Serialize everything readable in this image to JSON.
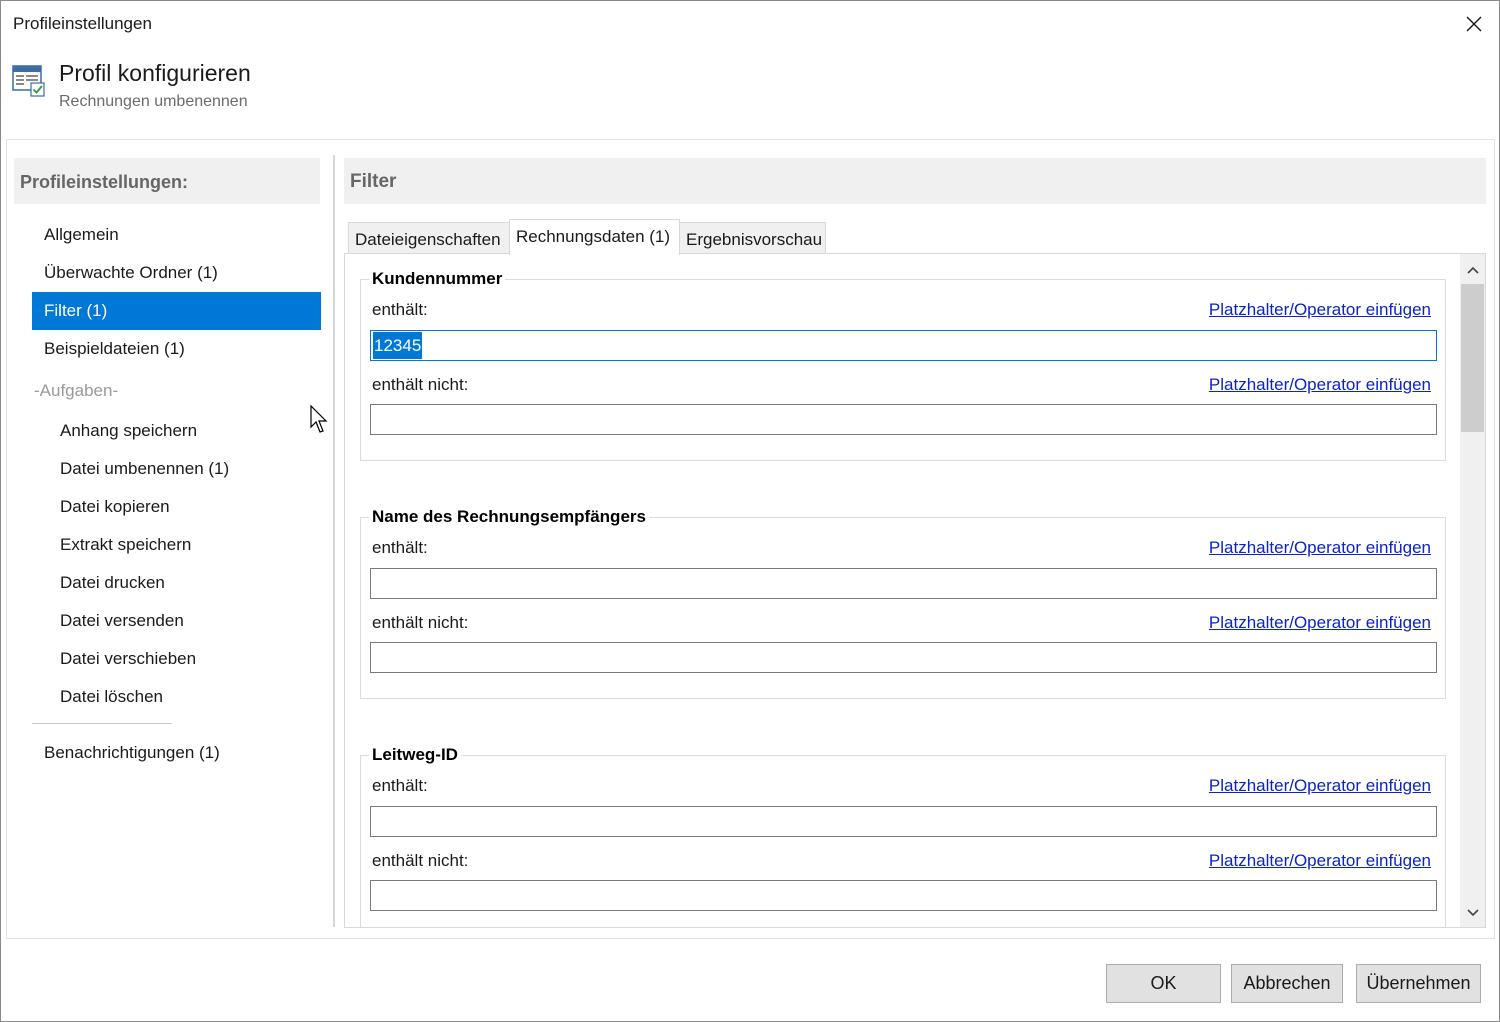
{
  "window": {
    "title": "Profileinstellungen",
    "header_title": "Profil konfigurieren",
    "header_subtitle": "Rechnungen umbenennen",
    "icons": {
      "close": "close-icon",
      "header": "profile-settings-icon"
    }
  },
  "sidebar": {
    "header": "Profileinstellungen:",
    "items": [
      {
        "label": "Allgemein"
      },
      {
        "label": "Überwachte Ordner (1)"
      },
      {
        "label": "Filter (1)",
        "selected": true
      },
      {
        "label": "Beispieldateien (1)"
      }
    ],
    "tasks_group_label": "-Aufgaben-",
    "tasks": [
      {
        "label": "Anhang speichern"
      },
      {
        "label": "Datei umbenennen (1)"
      },
      {
        "label": "Datei kopieren"
      },
      {
        "label": "Extrakt speichern"
      },
      {
        "label": "Datei drucken"
      },
      {
        "label": "Datei versenden"
      },
      {
        "label": "Datei verschieben"
      },
      {
        "label": "Datei löschen"
      }
    ],
    "footer_item": {
      "label": "Benachrichtigungen (1)"
    }
  },
  "main": {
    "title": "Filter",
    "tabs": [
      {
        "label": "Dateieigenschaften"
      },
      {
        "label": "Rechnungsdaten (1)",
        "active": true
      },
      {
        "label": "Ergebnisvorschau"
      }
    ],
    "groups": [
      {
        "title": "Kundennummer",
        "contains_label": "enthält:",
        "contains_value": "12345",
        "not_contains_label": "enthält nicht:",
        "not_contains_value": "",
        "link": "Platzhalter/Operator einfügen"
      },
      {
        "title": "Name des Rechnungsempfängers",
        "contains_label": "enthält:",
        "contains_value": "",
        "not_contains_label": "enthält nicht:",
        "not_contains_value": "",
        "link": "Platzhalter/Operator einfügen"
      },
      {
        "title": "Leitweg-ID",
        "contains_label": "enthält:",
        "contains_value": "",
        "not_contains_label": "enthält nicht:",
        "not_contains_value": "",
        "link": "Platzhalter/Operator einfügen"
      }
    ]
  },
  "buttons": {
    "ok": "OK",
    "cancel": "Abbrechen",
    "apply": "Übernehmen"
  },
  "colors": {
    "accent": "#0078d7",
    "link": "#0b23c8",
    "panel_header_bg": "#f0f0f0"
  }
}
